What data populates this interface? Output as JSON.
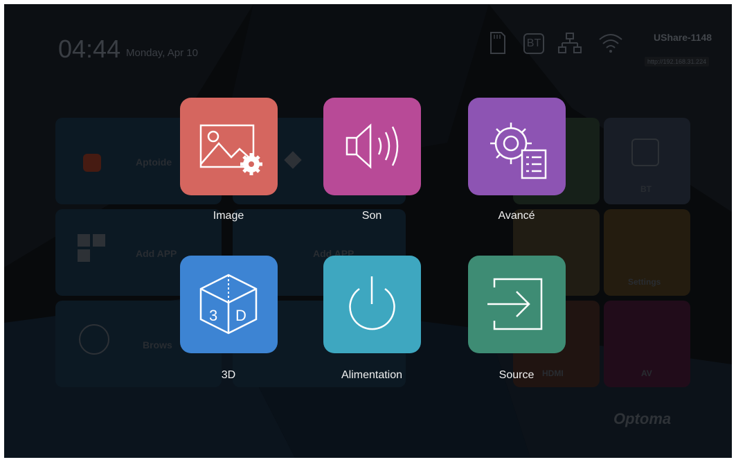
{
  "header": {
    "time": "04:44",
    "date": "Monday, Apr 10",
    "device_name": "UShare-1148",
    "share_url": "http://192.168.31.224",
    "bt_label": "BT"
  },
  "background_tiles": {
    "aptoide": "Aptoide",
    "add_app_1": "Add APP",
    "add_app_2": "Add APP",
    "browser": "Brows",
    "bt": "BT",
    "settings": "Settings",
    "hdmi": "HDMI",
    "av": "AV"
  },
  "menu": {
    "items": [
      {
        "label": "Image",
        "color": "#d5665f",
        "icon": "image-settings-icon"
      },
      {
        "label": "Son",
        "color": "#b84a97",
        "icon": "speaker-icon"
      },
      {
        "label": "Avancé",
        "color": "#8d54b3",
        "icon": "gear-list-icon"
      },
      {
        "label": "3D",
        "color": "#3d84d3",
        "icon": "cube-3d-icon"
      },
      {
        "label": "Alimentation",
        "color": "#3ea7c0",
        "icon": "power-icon"
      },
      {
        "label": "Source",
        "color": "#3e8c74",
        "icon": "source-input-icon"
      }
    ]
  },
  "brand": {
    "logo": "Optoma"
  }
}
